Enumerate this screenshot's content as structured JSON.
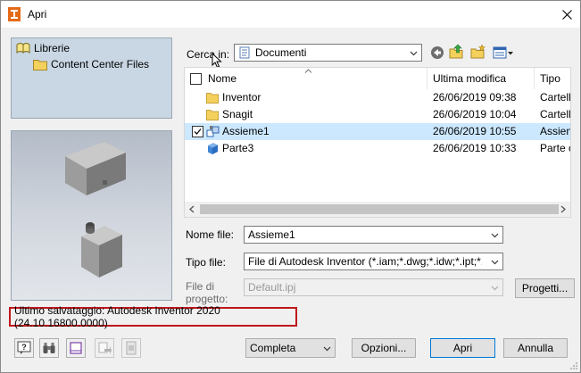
{
  "window": {
    "title": "Apri"
  },
  "libraries": {
    "root_label": "Librerie",
    "child_label": "Content Center Files"
  },
  "search": {
    "label": "Cerca in:",
    "value": "Documenti"
  },
  "list": {
    "columns": [
      "Nome",
      "Ultima modifica",
      "Tipo"
    ],
    "rows": [
      {
        "name": "Inventor",
        "modified": "26/06/2019 09:38",
        "type": "Cartell",
        "icon": "folder-icon"
      },
      {
        "name": "Snagit",
        "modified": "26/06/2019 10:04",
        "type": "Cartell",
        "icon": "folder-icon"
      },
      {
        "name": "Assieme1",
        "modified": "26/06/2019 10:55",
        "type": "Assien",
        "icon": "assembly-icon",
        "selected": true
      },
      {
        "name": "Parte3",
        "modified": "26/06/2019 10:33",
        "type": "Parte c",
        "icon": "part-icon"
      }
    ]
  },
  "form": {
    "filename_label": "Nome file:",
    "filename_value": "Assieme1",
    "filetype_label": "Tipo file:",
    "filetype_value": "File di Autodesk Inventor (*.iam;*.dwg;*.idw;*.ipt;*.ipn;*.ide",
    "project_label_1": "File di",
    "project_label_2": "progetto:",
    "project_value": "Default.ipj",
    "projects_button": "Progetti..."
  },
  "status_text": "Ultimo salvataggio: Autodesk Inventor 2020 (24.10.16800.0000)",
  "footer": {
    "mode_value": "Completa",
    "options_button": "Opzioni...",
    "open_button": "Apri",
    "cancel_button": "Annulla"
  },
  "colors": {
    "selection": "#cce8ff",
    "status_border": "#c0171b",
    "library_panel": "#c9d7e4",
    "folder": "#e8c24a"
  }
}
